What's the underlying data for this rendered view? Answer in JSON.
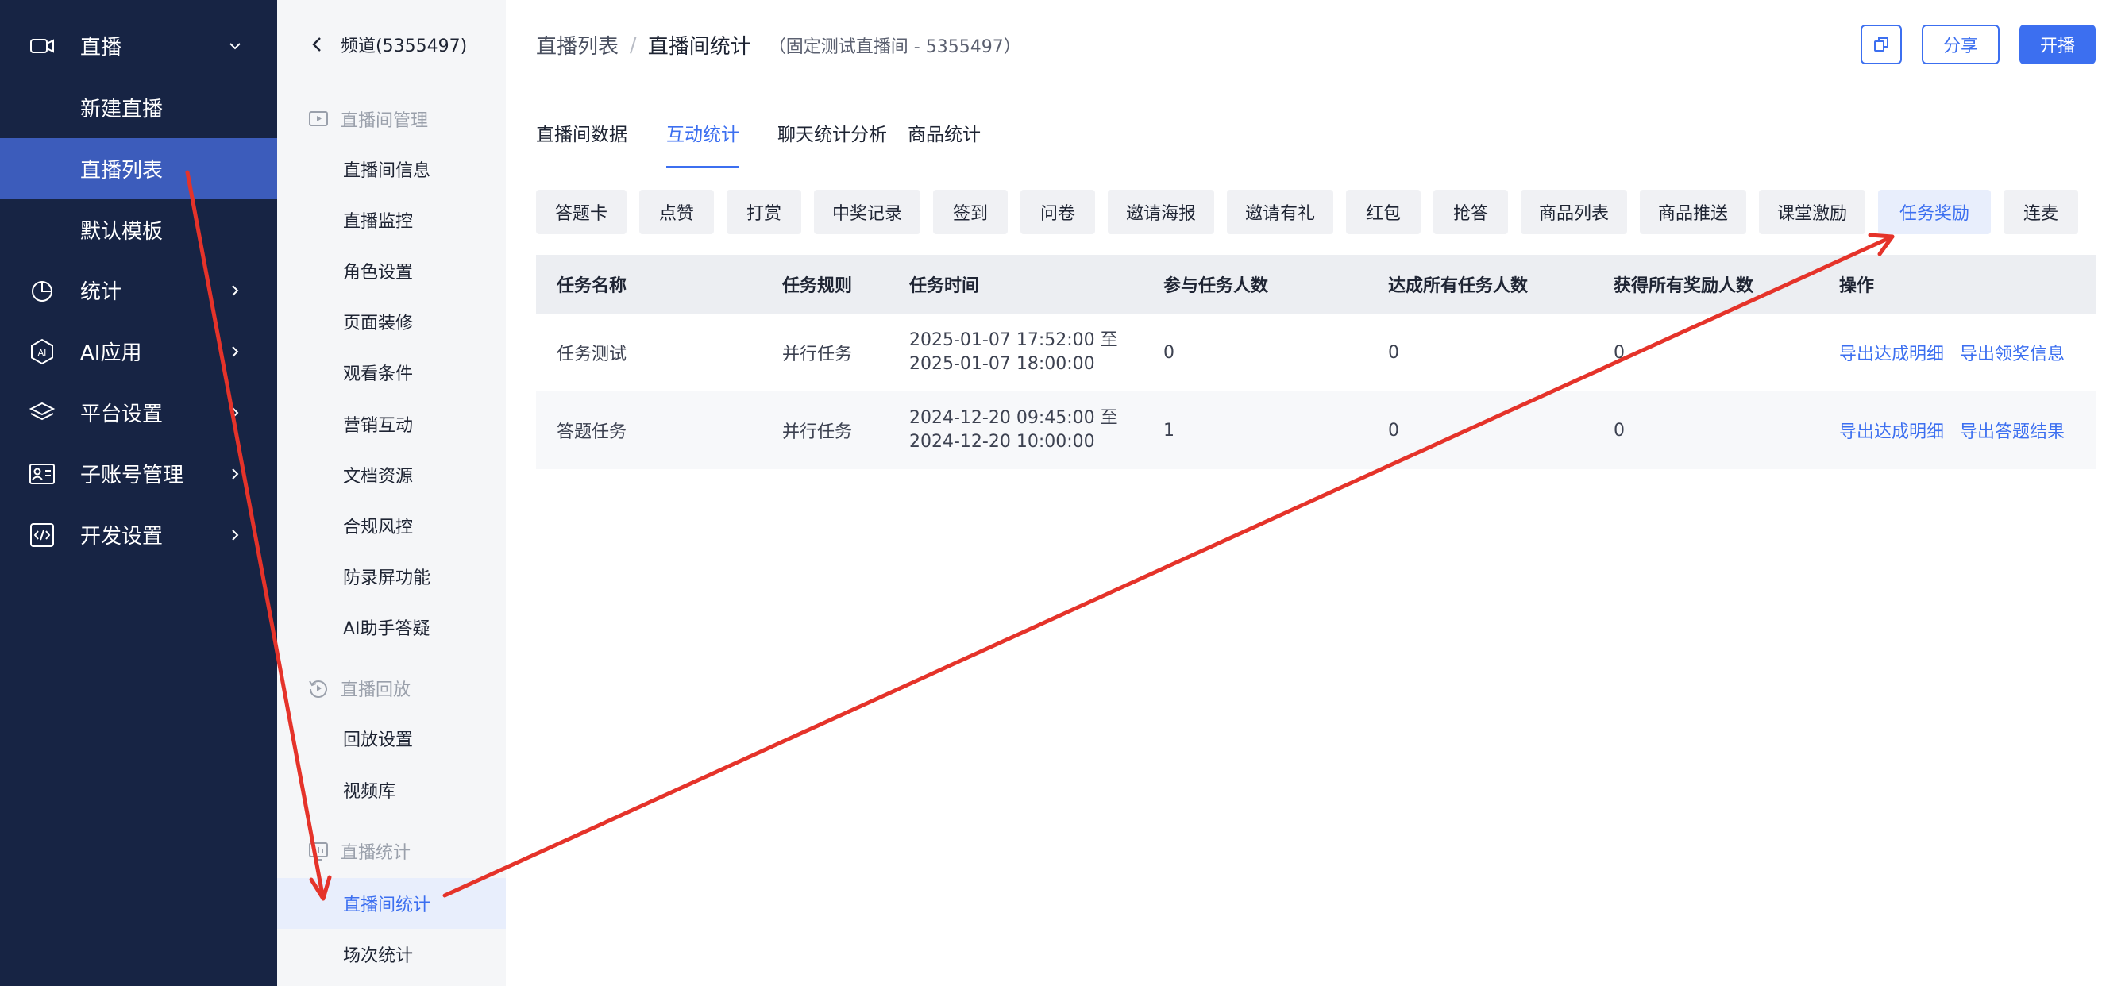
{
  "nav": {
    "live": "直播",
    "live_sub": [
      "新建直播",
      "直播列表",
      "默认模板"
    ],
    "stats": "统计",
    "ai_app": "AI应用",
    "platform_settings": "平台设置",
    "sub_accounts": "子账号管理",
    "dev_settings": "开发设置"
  },
  "menu": {
    "channel": "频道(5355497)",
    "group_manage": "直播间管理",
    "manage_items": [
      "直播间信息",
      "直播监控",
      "角色设置",
      "页面装修",
      "观看条件",
      "营销互动",
      "文档资源",
      "合规风控",
      "防录屏功能",
      "AI助手答疑"
    ],
    "group_replay": "直播回放",
    "replay_items": [
      "回放设置",
      "视频库"
    ],
    "group_stats": "直播统计",
    "stats_items": [
      "直播间统计",
      "场次统计"
    ]
  },
  "header": {
    "crumb_list": "直播列表",
    "crumb_sep": "/",
    "crumb_current": "直播间统计",
    "crumb_sub": "（固定测试直播间 - 5355497）",
    "share": "分享",
    "start_live": "开播"
  },
  "tabs": [
    "直播间数据",
    "互动统计",
    "聊天统计分析",
    "商品统计"
  ],
  "chips": [
    "答题卡",
    "点赞",
    "打赏",
    "中奖记录",
    "签到",
    "问卷",
    "邀请海报",
    "邀请有礼",
    "红包",
    "抢答",
    "商品列表",
    "商品推送",
    "课堂激励",
    "任务奖励",
    "连麦"
  ],
  "table": {
    "headers": [
      "任务名称",
      "任务规则",
      "任务时间",
      "参与任务人数",
      "达成所有任务人数",
      "获得所有奖励人数",
      "操作"
    ],
    "rows": [
      {
        "name": "任务测试",
        "rule": "并行任务",
        "time1": "2025-01-07 17:52:00 至",
        "time2": "2025-01-07 18:00:00",
        "participants": "0",
        "completed": "0",
        "rewarded": "0",
        "action1": "导出达成明细",
        "action2": "导出领奖信息"
      },
      {
        "name": "答题任务",
        "rule": "并行任务",
        "time1": "2024-12-20 09:45:00 至",
        "time2": "2024-12-20 10:00:00",
        "participants": "1",
        "completed": "0",
        "rewarded": "0",
        "action1": "导出达成明细",
        "action2": "导出答题结果"
      }
    ]
  },
  "colors": {
    "accent": "#3c6ff0",
    "nav_bg": "#172444",
    "nav_active": "#3c5cbb",
    "annotation": "#e5332a"
  }
}
